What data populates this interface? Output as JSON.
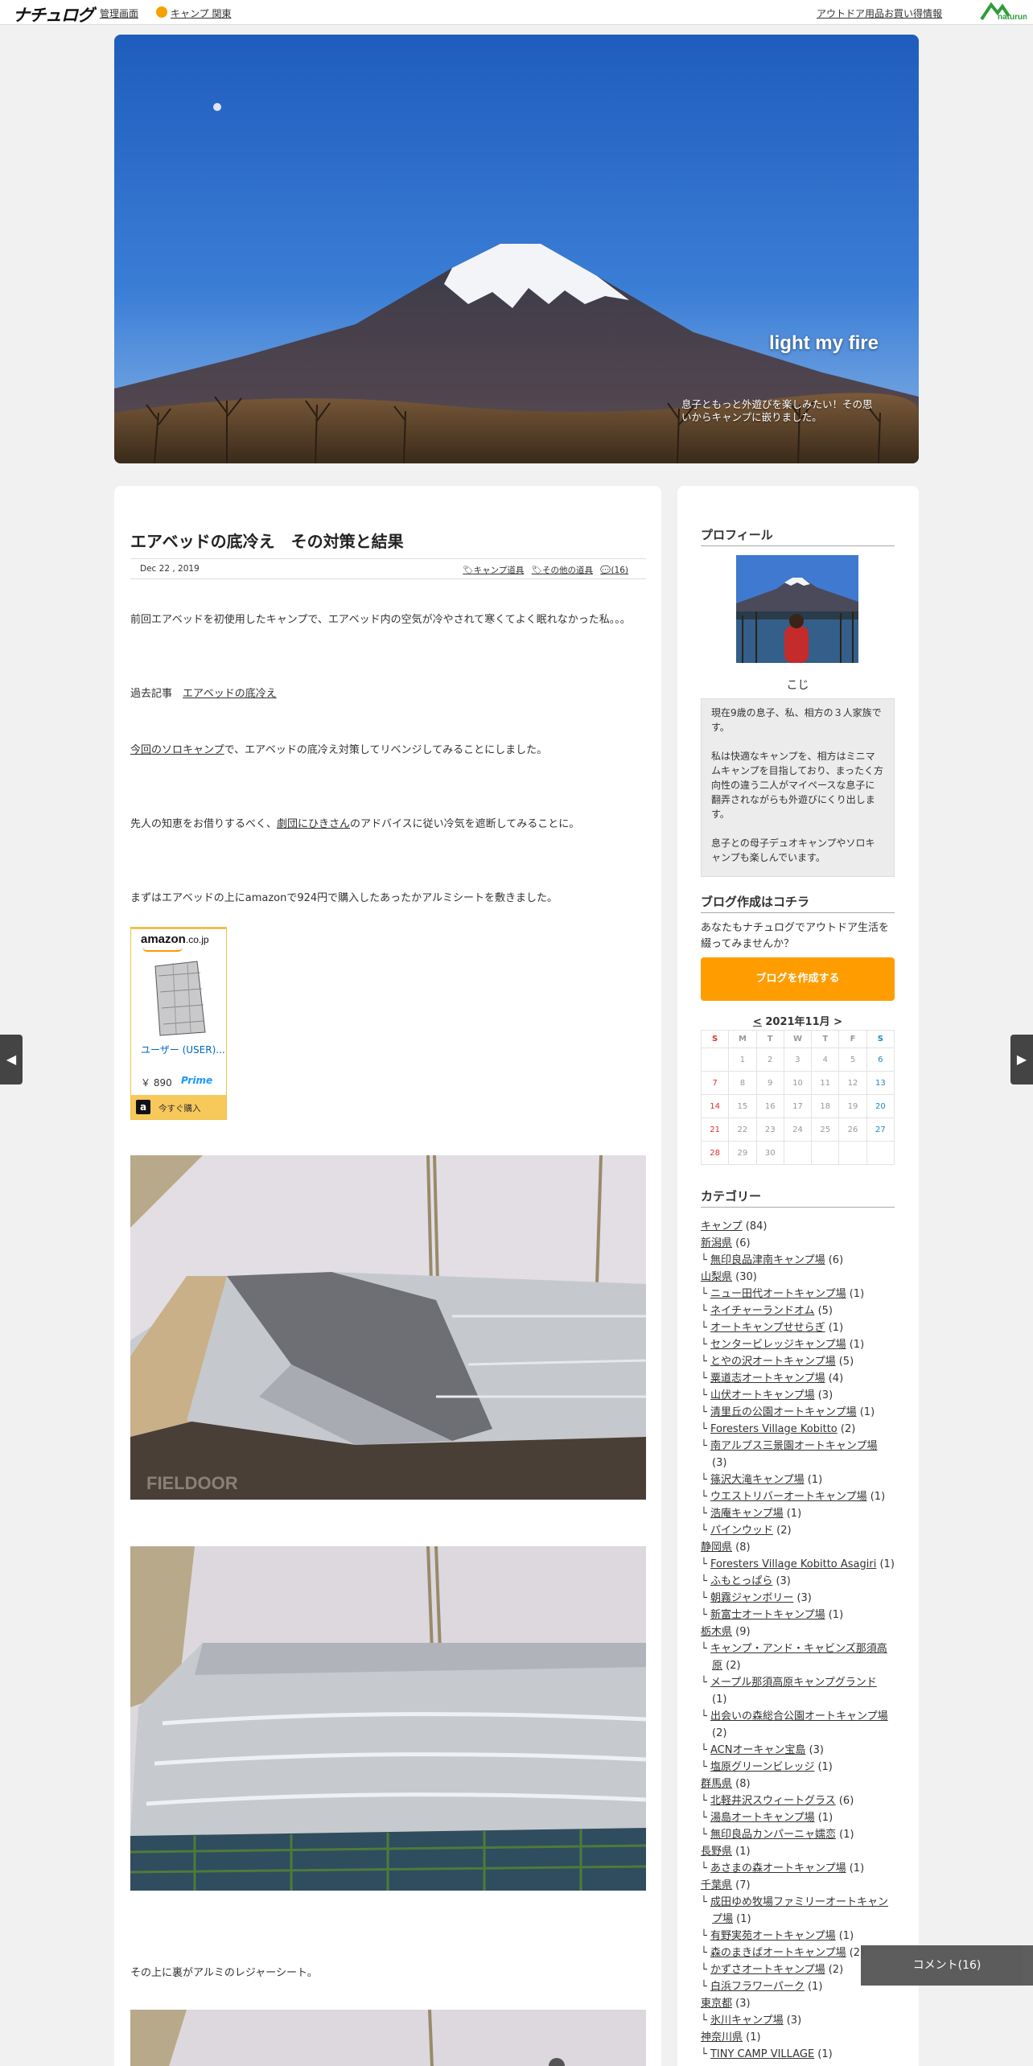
{
  "topbar": {
    "logo": "ナチュログ",
    "admin": "管理画面",
    "camp": "キャンプ 関東",
    "shop": "アウトドア用品お買い得情報"
  },
  "hero": {
    "title": "light my fire",
    "desc": "息子ともっと外遊びを楽しみたい！その思いからキャンプに嵌りました。"
  },
  "post": {
    "title": "エアベッドの底冷え　その対策と結果",
    "date": "Dec 22 , 2019",
    "tags": [
      "キャンプ道具",
      "その他の道具",
      "(16)"
    ],
    "p1": "前回エアベッドを初使用したキャンプで、エアベッド内の空気が冷やされて寒くてよく眠れなかった私。。。",
    "p2_prefix": "過去記事　",
    "p2_link": "エアベッドの底冷え",
    "p3_link": "今回のソロキャンプ",
    "p3_rest": "で、エアベッドの底冷え対策してリベンジしてみることにしました。",
    "p4_pre": "先人の知恵をお借りするべく、",
    "p4_link": "劇団にひきさん",
    "p4_rest": "のアドバイスに従い冷気を遮断してみることに。",
    "p5": "まずはエアベッドの上にamazonで924円で購入したあったかアルミシートを敷きました。",
    "p6": "その上に裏がアルミのレジャーシート。"
  },
  "amazon": {
    "logo": "amazon",
    "domain": ".co.jp",
    "user": "ユーザー (USER)...",
    "price": "￥ 890",
    "prime": "Prime",
    "buy": "今すぐ購入"
  },
  "sidebar": {
    "profile_h": "プロフィール",
    "name": "こじ",
    "profile": [
      "現在9歳の息子、私、相方の３人家族です。",
      "私は快適なキャンプを、相方はミニマムキャンプを目指しており、まったく方向性の違う二人がマイペースな息子に翻弄されながらも外遊びにくり出します。",
      "息子との母子デュオキャンプやソロキャンプも楽しんでいます。"
    ],
    "create_h": "ブログ作成はコチラ",
    "create_text": "あなたもナチュログでアウトドア生活を綴ってみませんか？",
    "create_btn": "ブログを作成する",
    "cal_prev": "<",
    "cal_title": "2021年11月",
    "cal_next": ">",
    "cal_days": [
      "S",
      "M",
      "T",
      "W",
      "T",
      "F",
      "S"
    ],
    "cal_rows": [
      [
        "",
        "1",
        "2",
        "3",
        "4",
        "5",
        "6"
      ],
      [
        "7",
        "8",
        "9",
        "10",
        "11",
        "12",
        "13"
      ],
      [
        "14",
        "15",
        "16",
        "17",
        "18",
        "19",
        "20"
      ],
      [
        "21",
        "22",
        "23",
        "24",
        "25",
        "26",
        "27"
      ],
      [
        "28",
        "29",
        "30",
        "",
        "",
        "",
        ""
      ]
    ],
    "cat_h": "カテゴリー",
    "categories": [
      {
        "t": "c",
        "n": "キャンプ",
        "c": " (84)"
      },
      {
        "t": "c",
        "n": "新潟県",
        "c": " (6)"
      },
      {
        "t": "s",
        "n": "無印良品津南キャンプ場",
        "c": " (6)"
      },
      {
        "t": "c",
        "n": "山梨県",
        "c": " (30)"
      },
      {
        "t": "s",
        "n": "ニュー田代オートキャンプ場",
        "c": " (1)"
      },
      {
        "t": "s",
        "n": "ネイチャーランドオム",
        "c": " (5)"
      },
      {
        "t": "s",
        "n": "オートキャンプせせらぎ",
        "c": " (1)"
      },
      {
        "t": "s",
        "n": "センタービレッジキャンプ場",
        "c": " (1)"
      },
      {
        "t": "s",
        "n": "とやの沢オートキャンプ場",
        "c": " (5)"
      },
      {
        "t": "s",
        "n": "粟道志オートキャンプ場",
        "c": " (4)"
      },
      {
        "t": "s",
        "n": "山伏オートキャンプ場",
        "c": " (3)"
      },
      {
        "t": "s",
        "n": "清里丘の公園オートキャンプ場",
        "c": " (1)"
      },
      {
        "t": "s",
        "n": "Foresters Village Kobitto",
        "c": " (2)"
      },
      {
        "t": "s",
        "n": "南アルプス三景園オートキャンプ場",
        "c": " (3)"
      },
      {
        "t": "s",
        "n": "篠沢大滝キャンプ場",
        "c": " (1)"
      },
      {
        "t": "s",
        "n": "ウエストリバーオートキャンプ場",
        "c": " (1)"
      },
      {
        "t": "s",
        "n": "浩庵キャンプ場",
        "c": " (1)"
      },
      {
        "t": "s",
        "n": "パインウッド",
        "c": " (2)"
      },
      {
        "t": "c",
        "n": "静岡県",
        "c": " (8)"
      },
      {
        "t": "s",
        "n": "Foresters Village Kobitto Asagiri",
        "c": " (1)"
      },
      {
        "t": "s",
        "n": "ふもとっぱら",
        "c": " (3)"
      },
      {
        "t": "s",
        "n": "朝霧ジャンボリー",
        "c": " (3)"
      },
      {
        "t": "s",
        "n": "新富士オートキャンプ場",
        "c": " (1)"
      },
      {
        "t": "c",
        "n": "栃木県",
        "c": " (9)"
      },
      {
        "t": "s",
        "n": "キャンプ・アンド・キャビンズ那須高原",
        "c": " (2)"
      },
      {
        "t": "s",
        "n": "メープル那須高原キャンプグランド",
        "c": " (1)"
      },
      {
        "t": "s",
        "n": "出会いの森総合公園オートキャンプ場",
        "c": " (2)"
      },
      {
        "t": "s",
        "n": "ACNオーキャン宝島",
        "c": " (3)"
      },
      {
        "t": "s",
        "n": "塩原グリーンビレッジ",
        "c": " (1)"
      },
      {
        "t": "c",
        "n": "群馬県",
        "c": " (8)"
      },
      {
        "t": "s",
        "n": "北軽井沢スウィートグラス",
        "c": " (6)"
      },
      {
        "t": "s",
        "n": "湯島オートキャンプ場",
        "c": " (1)"
      },
      {
        "t": "s",
        "n": "無印良品カンパーニャ嬬恋",
        "c": " (1)"
      },
      {
        "t": "c",
        "n": "長野県",
        "c": " (1)"
      },
      {
        "t": "s",
        "n": "あさまの森オートキャンプ場",
        "c": " (1)"
      },
      {
        "t": "c",
        "n": "千葉県",
        "c": " (7)"
      },
      {
        "t": "s",
        "n": "成田ゆめ牧場ファミリーオートキャンプ場",
        "c": " (1)"
      },
      {
        "t": "s",
        "n": "有野実苑オートキャンプ場",
        "c": " (1)"
      },
      {
        "t": "s",
        "n": "森のまきばオートキャンプ場",
        "c": " (2)"
      },
      {
        "t": "s",
        "n": "かずさオートキャンプ場",
        "c": " (2)"
      },
      {
        "t": "s",
        "n": "白浜フラワーパーク",
        "c": " (1)"
      },
      {
        "t": "c",
        "n": "東京都",
        "c": " (3)"
      },
      {
        "t": "s",
        "n": "氷川キャンプ場",
        "c": " (3)"
      },
      {
        "t": "c",
        "n": "神奈川県",
        "c": " (1)"
      },
      {
        "t": "s",
        "n": "TINY CAMP VILLAGE",
        "c": " (1)"
      }
    ]
  },
  "nav": {
    "prev": "◀",
    "next": "▶"
  },
  "comment": "コメント(16)"
}
